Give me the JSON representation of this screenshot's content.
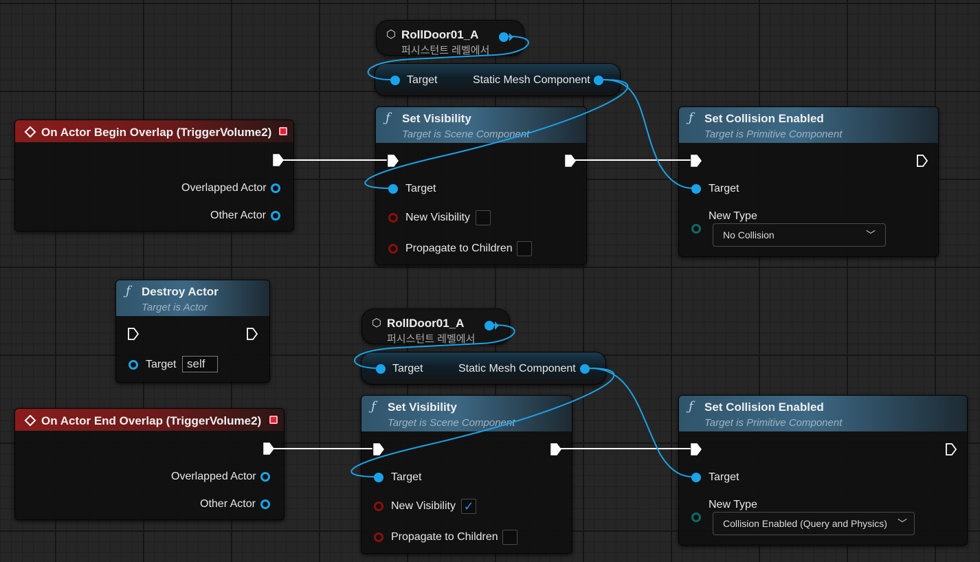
{
  "colors": {
    "exec_wire": "#ffffff",
    "object_wire": "#1aa3e8",
    "event_header": "#8a1c1c",
    "function_header": "#3d6884"
  },
  "upper": {
    "actor_ref": {
      "name": "RollDoor01_A",
      "subtitle": "퍼시스턴트 레벨에서"
    },
    "get_component": {
      "target_label": "Target",
      "output_label": "Static Mesh Component"
    },
    "event": {
      "title": "On Actor Begin Overlap (TriggerVolume2)",
      "pins": [
        "Overlapped Actor",
        "Other Actor"
      ]
    },
    "set_visibility": {
      "title": "Set Visibility",
      "subtitle": "Target is Scene Component",
      "target_label": "Target",
      "new_visibility_label": "New Visibility",
      "new_visibility_checked": false,
      "propagate_label": "Propagate to Children",
      "propagate_checked": false
    },
    "set_collision": {
      "title": "Set Collision Enabled",
      "subtitle": "Target is Primitive Component",
      "target_label": "Target",
      "new_type_label": "New Type",
      "new_type_value": "No Collision"
    }
  },
  "destroy_actor": {
    "title": "Destroy Actor",
    "subtitle": "Target is Actor",
    "target_label": "Target",
    "target_value": "self"
  },
  "lower": {
    "actor_ref": {
      "name": "RollDoor01_A",
      "subtitle": "퍼시스턴트 레벨에서"
    },
    "get_component": {
      "target_label": "Target",
      "output_label": "Static Mesh Component"
    },
    "event": {
      "title": "On Actor End Overlap (TriggerVolume2)",
      "pins": [
        "Overlapped Actor",
        "Other Actor"
      ]
    },
    "set_visibility": {
      "title": "Set Visibility",
      "subtitle": "Target is Scene Component",
      "target_label": "Target",
      "new_visibility_label": "New Visibility",
      "new_visibility_checked": true,
      "propagate_label": "Propagate to Children",
      "propagate_checked": false
    },
    "set_collision": {
      "title": "Set Collision Enabled",
      "subtitle": "Target is Primitive Component",
      "target_label": "Target",
      "new_type_label": "New Type",
      "new_type_value": "Collision Enabled (Query and Physics)"
    }
  }
}
